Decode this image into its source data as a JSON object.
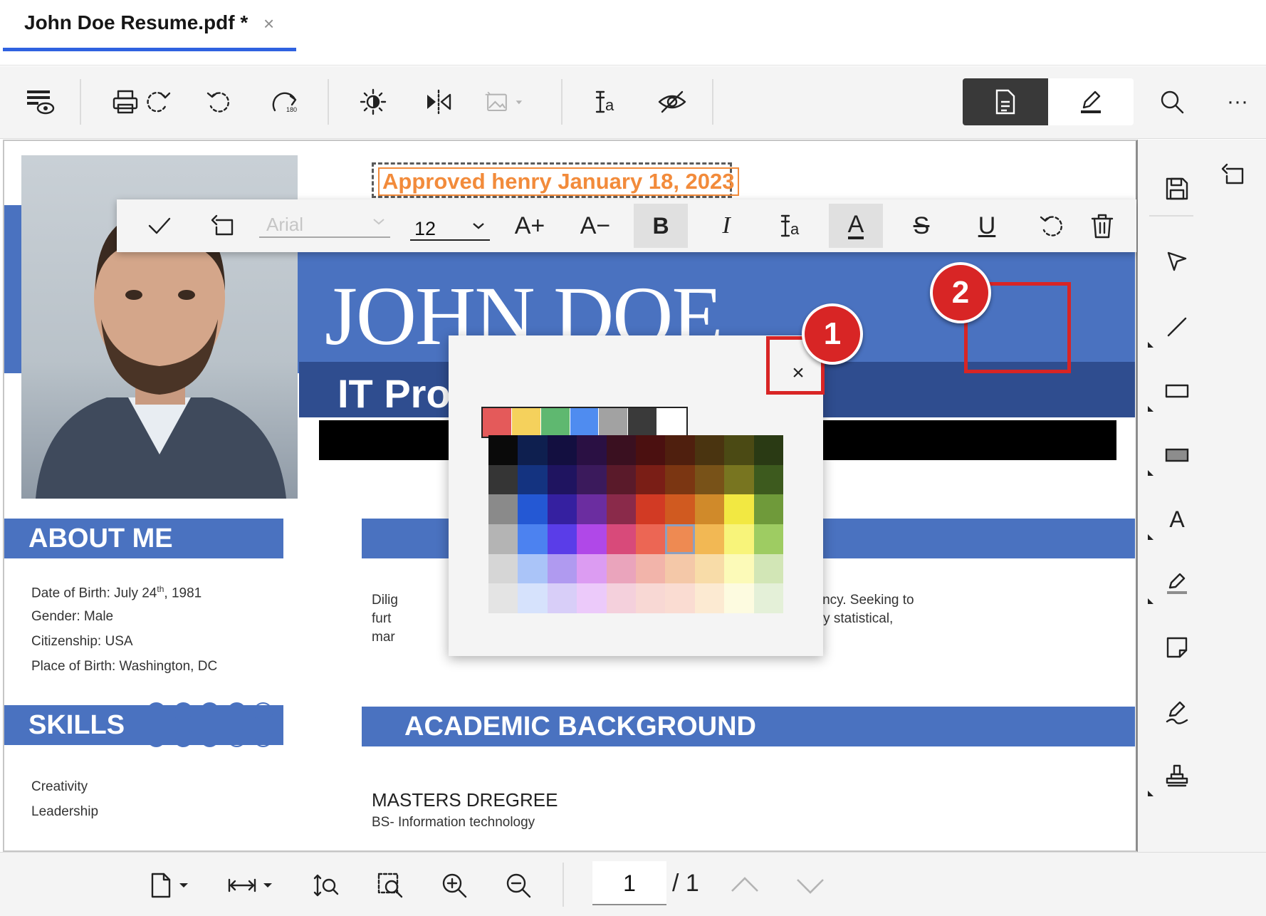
{
  "tab": {
    "title": "John Doe Resume.pdf *",
    "close_glyph": "×"
  },
  "toolbar": {
    "icons": [
      "view-options-icon",
      "print-icon",
      "rotate-page-icon",
      "rotate-left-icon",
      "rotate-180-icon",
      "brightness-icon",
      "flip-horizontal-icon",
      "image-effects-icon",
      "text-format-icon",
      "hide-icon",
      "document-mode-icon",
      "edit-mode-icon",
      "search-icon",
      "more-icon"
    ],
    "more_glyph": "···"
  },
  "document": {
    "approved_stamp": "Approved henry January 18, 2023",
    "name": "JOHN DOE",
    "job_title_visible": "IT Proj",
    "about_heading": "ABOUT ME",
    "about_items": [
      {
        "label": "Date of Birth: July 24",
        "sup": "th",
        "suffix": ", 1981"
      },
      {
        "label": "Gender: Male"
      },
      {
        "label": "Citizenship: USA"
      },
      {
        "label": "Place of Birth: Washington, DC"
      }
    ],
    "summary_lines": [
      "Dilig",
      "furt",
      "mar"
    ],
    "summary_lines_right": [
      "ud services agency. Seeking to",
      "by leveraging my statistical,"
    ],
    "skills_heading": "SKILLS",
    "skills": [
      {
        "name": "Creativity",
        "level": 4,
        "max": 5
      },
      {
        "name": "Leadership",
        "level": 3,
        "max": 5
      }
    ],
    "academic_heading": "ACADEMIC BACKGROUND",
    "degree": "MASTERS DREGREE",
    "degree_field": "BS- Information technology"
  },
  "text_toolbar": {
    "font_value": "Arial",
    "size_value": "12",
    "increase_font": "A+",
    "decrease_font": "A−",
    "bold": "B",
    "italic": "I",
    "font_color": "A",
    "strike": "S",
    "underline": "U"
  },
  "palette": {
    "close_glyph": "×",
    "quick_colors": [
      "#e45a5a",
      "#f5d15c",
      "#5fb870",
      "#4f8cf0",
      "#a2a2a2",
      "#3a3a3a",
      "#ffffff"
    ],
    "grid": [
      [
        "#0a0a0a",
        "#0e1f4f",
        "#130f40",
        "#2a1043",
        "#3a1020",
        "#4b1010",
        "#4f1f0e",
        "#4a3410",
        "#4b4a14",
        "#2a3a14"
      ],
      [
        "#353535",
        "#143380",
        "#1f1460",
        "#3b1a5c",
        "#5a1a2a",
        "#7a1e16",
        "#7b3612",
        "#785218",
        "#787520",
        "#3d5a1e"
      ],
      [
        "#8a8a8a",
        "#2458d4",
        "#3520a0",
        "#6b2da0",
        "#8a2a4a",
        "#d23a24",
        "#d05a20",
        "#d08a2a",
        "#f2e842",
        "#6f9a3a"
      ],
      [
        "#b4b4b4",
        "#4c82f0",
        "#5a3de8",
        "#b048e8",
        "#d84a7a",
        "#ec6654",
        "#ee8a52",
        "#f2b854",
        "#f8f47a",
        "#9ecc62"
      ],
      [
        "#d6d6d6",
        "#aac4f8",
        "#b09af0",
        "#dc9cf2",
        "#eaa4bc",
        "#f2b4aa",
        "#f4c8a8",
        "#f8dca8",
        "#fcfab8",
        "#d2e6b6"
      ],
      [
        "#e4e4e4",
        "#d6e2fc",
        "#d8cef8",
        "#eccafa",
        "#f4d0dc",
        "#f8d8d4",
        "#fadcd2",
        "#fcead2",
        "#fdfbe0",
        "#e4f0d8"
      ]
    ],
    "selected": {
      "row": 3,
      "col": 6
    }
  },
  "callouts": [
    "1",
    "2"
  ],
  "sidebar": {
    "icons": [
      "undo-back-icon",
      "save-icon",
      "select-icon",
      "line-icon",
      "rectangle-icon",
      "filled-rectangle-icon",
      "text-icon",
      "highlight-icon",
      "note-icon",
      "signature-icon",
      "stamp-icon"
    ],
    "text_glyph": "A"
  },
  "bottom": {
    "page_current": "1",
    "page_total": "/ 1"
  }
}
